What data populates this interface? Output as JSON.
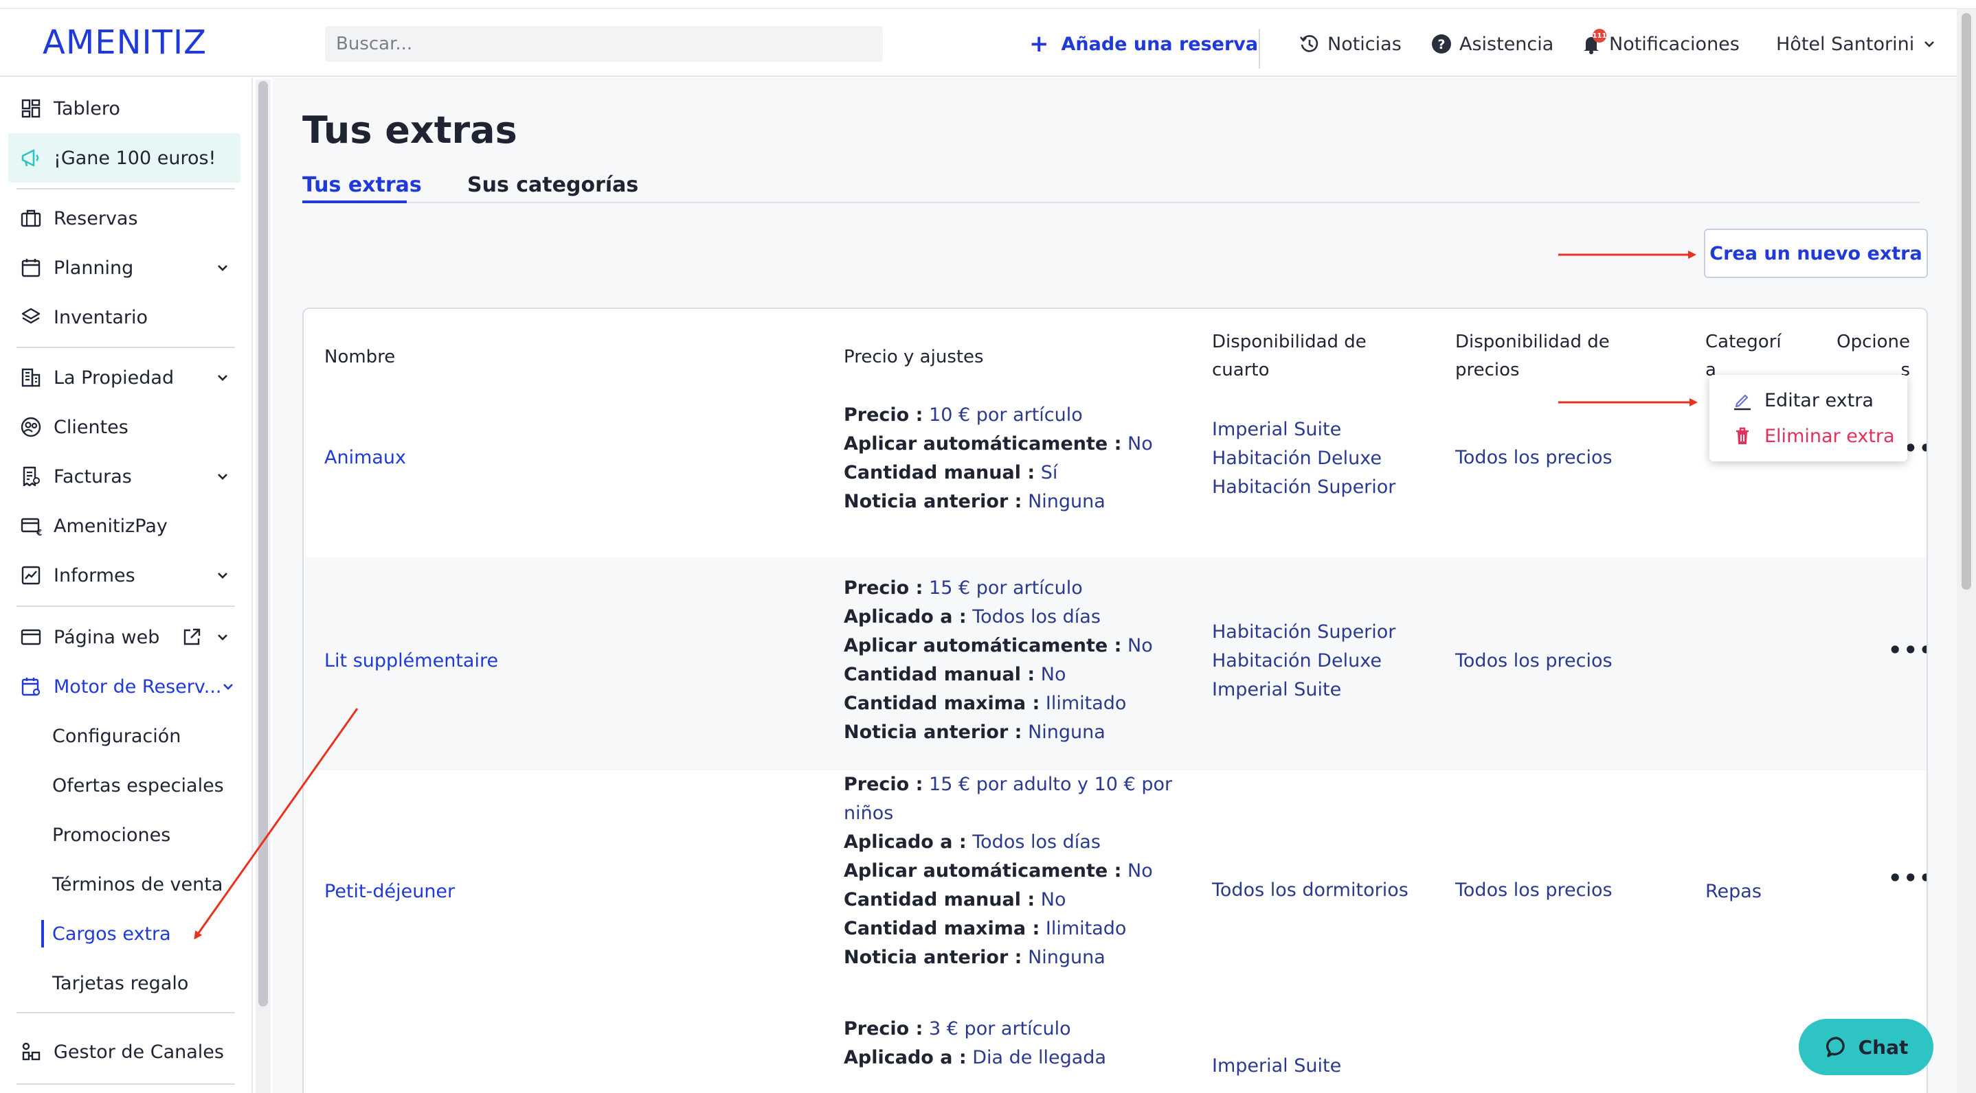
{
  "header": {
    "logo": "AMENITIZ",
    "search_placeholder": "Buscar...",
    "add_reservation": "Añade una reserva",
    "news": "Noticias",
    "help": "Asistencia",
    "notifications": "Notificaciones",
    "notifications_badge": "111",
    "hotel": "Hôtel Santorini"
  },
  "sidebar": {
    "dashboard": "Tablero",
    "promo": "¡Gane 100 euros!",
    "reservations": "Reservas",
    "planning": "Planning",
    "inventory": "Inventario",
    "property": "La Propiedad",
    "clients": "Clientes",
    "invoices": "Facturas",
    "amenitizpay": "AmenitizPay",
    "reports": "Informes",
    "website": "Página web",
    "booking_engine": "Motor de Reserv...",
    "sub": {
      "config": "Configuración",
      "special_offers": "Ofertas especiales",
      "promotions": "Promociones",
      "terms": "Términos de venta",
      "extra_charges": "Cargos extra",
      "gift_cards": "Tarjetas regalo"
    },
    "channel_manager": "Gestor de Canales"
  },
  "page": {
    "title": "Tus extras",
    "tab_extras": "Tus extras",
    "tab_categories": "Sus categorías",
    "create_button": "Crea un nuevo extra"
  },
  "table": {
    "headers": {
      "name": "Nombre",
      "price": "Precio y ajustes",
      "room_l1": "Disponibilidad de",
      "room_l2": "cuarto",
      "rate_l1": "Disponibilidad de",
      "rate_l2": "precios",
      "cat_l1": "Categorí",
      "cat_l2": "a",
      "opt_l1": "Opcione",
      "opt_l2": "s"
    },
    "rows": [
      {
        "name": "Animaux",
        "price": [
          {
            "label": "Precio :",
            "value": "10 € por artículo"
          },
          {
            "label": "Aplicar automáticamente :",
            "value": "No"
          },
          {
            "label": "Cantidad manual :",
            "value": "Sí"
          },
          {
            "label": "Noticia anterior :",
            "value": "Ninguna"
          }
        ],
        "rooms": [
          "Imperial Suite",
          "Habitación Deluxe",
          "Habitación Superior"
        ],
        "rates": "Todos los precios",
        "category": ""
      },
      {
        "name": "Lit supplémentaire",
        "price": [
          {
            "label": "Precio :",
            "value": "15 € por artículo"
          },
          {
            "label": "Aplicado a :",
            "value": "Todos los días"
          },
          {
            "label": "Aplicar automáticamente :",
            "value": "No"
          },
          {
            "label": "Cantidad manual :",
            "value": "No"
          },
          {
            "label": "Cantidad maxima :",
            "value": "Ilimitado"
          },
          {
            "label": "Noticia anterior :",
            "value": "Ninguna"
          }
        ],
        "rooms": [
          "Habitación Superior",
          "Habitación Deluxe",
          "Imperial Suite"
        ],
        "rates": "Todos los precios",
        "category": ""
      },
      {
        "name": "Petit-déjeuner",
        "price_first": {
          "label": "Precio :",
          "value_l1": "15 € por adulto y 10 € por",
          "value_l2": "niños"
        },
        "price": [
          {
            "label": "Aplicado a :",
            "value": "Todos los días"
          },
          {
            "label": "Aplicar automáticamente :",
            "value": "No"
          },
          {
            "label": "Cantidad manual :",
            "value": "No"
          },
          {
            "label": "Cantidad maxima :",
            "value": "Ilimitado"
          },
          {
            "label": "Noticia anterior :",
            "value": "Ninguna"
          }
        ],
        "rooms": [
          "Todos los dormitorios"
        ],
        "rates": "Todos los precios",
        "category": "Repas"
      },
      {
        "name": "",
        "price": [
          {
            "label": "Precio :",
            "value": "3 € por artículo"
          },
          {
            "label": "Aplicado a :",
            "value": "Dia de llegada"
          }
        ],
        "rooms": [
          "Imperial Suite"
        ],
        "rates": "",
        "category": ""
      }
    ],
    "options_glyph": "•••"
  },
  "menu": {
    "edit": "Editar extra",
    "delete": "Eliminar extra"
  },
  "chat": "Chat",
  "colors": {
    "brand_blue": "#1f3ad9",
    "delete_pink": "#e0325a",
    "chat_teal": "#2ec4c4",
    "annotation_red": "#e8321e"
  }
}
